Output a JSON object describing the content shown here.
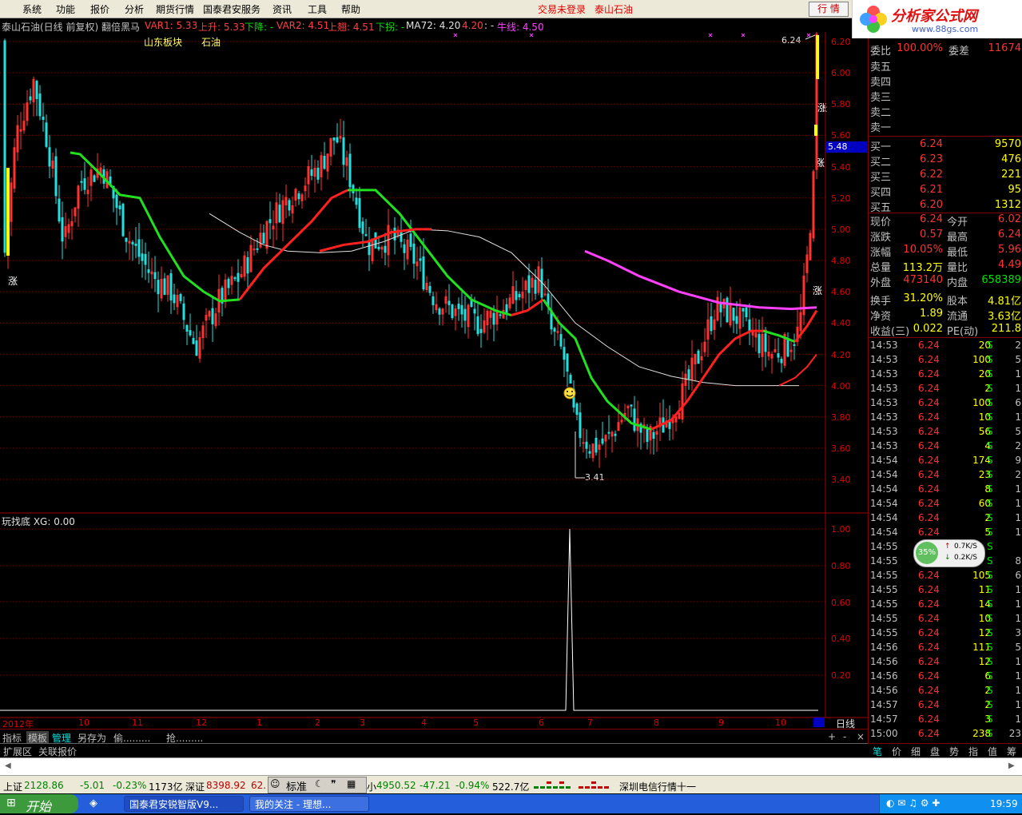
{
  "menu": {
    "items": [
      "系统",
      "功能",
      "报价",
      "分析",
      "期货行情",
      "国泰君安服务",
      "资讯",
      "工具",
      "帮助"
    ],
    "status_login": "交易未登录",
    "stock_name": "泰山石油",
    "hq_button": "行 情",
    "logo_text": "分析家公式网",
    "logo_url": "www.88gs.com"
  },
  "chart_header": {
    "title": "泰山石油(日线 前复权) 翻倍黑马",
    "var1": "VAR1: 5.33",
    "up": "上升: 5.33",
    "down": "下降: -",
    "var2": "VAR2: 4.51",
    "up_jump": "上翘: 4.51",
    "down_pull": "下拐: -",
    "ma72": "MA72: 4.20",
    "ma72b": "4.20",
    "ma72c": ": -",
    "bull": "牛线: 4.50",
    "block_label": "山东板块",
    "block_name": "石油",
    "high_label": "6.24",
    "low_label": "3.41",
    "rise_marks": [
      "涨",
      "涨",
      "涨",
      "涨"
    ]
  },
  "price_axis": [
    "6.20",
    "6.00",
    "5.80",
    "5.60",
    "5.40",
    "5.20",
    "5.00",
    "4.80",
    "4.60",
    "4.40",
    "4.20",
    "4.00",
    "3.80",
    "3.60",
    "3.40"
  ],
  "price_axis_highlight": "5.48",
  "indicator": {
    "title": "玩找底 XG: 0.00",
    "axis": [
      "1.00",
      "0.80",
      "0.60",
      "0.40",
      "0.20"
    ]
  },
  "time_axis": [
    "2012年",
    "10",
    "11",
    "12",
    "1",
    "2",
    "3",
    "4",
    "5",
    "6",
    "7",
    "8",
    "9",
    "10"
  ],
  "period_label": "日线",
  "tabs": [
    "指标",
    "模板",
    "管理",
    "另存为",
    "偷.........",
    "抢........."
  ],
  "ext_tabs": [
    "扩展区",
    "关联报价"
  ],
  "quote": {
    "weibi_label": "委比",
    "weibi": "100.00%",
    "weicha_label": "委差",
    "weicha": "11674",
    "sell": [
      {
        "label": "卖五",
        "price": "",
        "vol": ""
      },
      {
        "label": "卖四",
        "price": "",
        "vol": ""
      },
      {
        "label": "卖三",
        "price": "",
        "vol": ""
      },
      {
        "label": "卖二",
        "price": "",
        "vol": ""
      },
      {
        "label": "卖一",
        "price": "",
        "vol": ""
      }
    ],
    "buy": [
      {
        "label": "买一",
        "price": "6.24",
        "vol": "9570"
      },
      {
        "label": "买二",
        "price": "6.23",
        "vol": "476"
      },
      {
        "label": "买三",
        "price": "6.22",
        "vol": "221"
      },
      {
        "label": "买四",
        "price": "6.21",
        "vol": "95"
      },
      {
        "label": "买五",
        "price": "6.20",
        "vol": "1312"
      }
    ],
    "stats": [
      {
        "l1": "现价",
        "v1": "6.24",
        "l2": "今开",
        "v2": "6.02"
      },
      {
        "l1": "涨跌",
        "v1": "0.57",
        "l2": "最高",
        "v2": "6.24"
      },
      {
        "l1": "涨幅",
        "v1": "10.05%",
        "l2": "最低",
        "v2": "5.96"
      },
      {
        "l1": "总量",
        "v1": "113.2万",
        "l2": "量比",
        "v2": "4.49"
      },
      {
        "l1": "外盘",
        "v1": "473140",
        "l2": "内盘",
        "v2": "658389"
      },
      {
        "l1": "换手",
        "v1": "31.20%",
        "l2": "股本",
        "v2": "4.81亿"
      },
      {
        "l1": "净资",
        "v1": "1.89",
        "l2": "流通",
        "v2": "3.63亿"
      },
      {
        "l1": "收益(三)",
        "v1": "0.022",
        "l2": "PE(动)",
        "v2": "211.8"
      }
    ],
    "ticks": [
      {
        "t": "14:53",
        "p": "6.24",
        "v": "20",
        "s": "S",
        "n": "2"
      },
      {
        "t": "14:53",
        "p": "6.24",
        "v": "100",
        "s": "S",
        "n": "5"
      },
      {
        "t": "14:53",
        "p": "6.24",
        "v": "20",
        "s": "S",
        "n": "1"
      },
      {
        "t": "14:53",
        "p": "6.24",
        "v": "2",
        "s": "S",
        "n": "1"
      },
      {
        "t": "14:53",
        "p": "6.24",
        "v": "100",
        "s": "S",
        "n": "6"
      },
      {
        "t": "14:53",
        "p": "6.24",
        "v": "10",
        "s": "S",
        "n": "1"
      },
      {
        "t": "14:53",
        "p": "6.24",
        "v": "56",
        "s": "S",
        "n": "5"
      },
      {
        "t": "14:53",
        "p": "6.24",
        "v": "4",
        "s": "S",
        "n": "2"
      },
      {
        "t": "14:54",
        "p": "6.24",
        "v": "174",
        "s": "S",
        "n": "9"
      },
      {
        "t": "14:54",
        "p": "6.24",
        "v": "23",
        "s": "S",
        "n": "2"
      },
      {
        "t": "14:54",
        "p": "6.24",
        "v": "8",
        "s": "S",
        "n": "1"
      },
      {
        "t": "14:54",
        "p": "6.24",
        "v": "60",
        "s": "S",
        "n": "1"
      },
      {
        "t": "14:54",
        "p": "6.24",
        "v": "2",
        "s": "S",
        "n": "1"
      },
      {
        "t": "14:54",
        "p": "6.24",
        "v": "5",
        "s": "S",
        "n": "1"
      },
      {
        "t": "14:55",
        "p": "6.24",
        "v": "",
        "s": "S",
        "n": ""
      },
      {
        "t": "14:55",
        "p": "6.24",
        "v": "",
        "s": "S",
        "n": "8"
      },
      {
        "t": "14:55",
        "p": "6.24",
        "v": "105",
        "s": "S",
        "n": "6"
      },
      {
        "t": "14:55",
        "p": "6.24",
        "v": "11",
        "s": "S",
        "n": "1"
      },
      {
        "t": "14:55",
        "p": "6.24",
        "v": "14",
        "s": "S",
        "n": "1"
      },
      {
        "t": "14:55",
        "p": "6.24",
        "v": "10",
        "s": "S",
        "n": "1"
      },
      {
        "t": "14:55",
        "p": "6.24",
        "v": "12",
        "s": "S",
        "n": "3"
      },
      {
        "t": "14:56",
        "p": "6.24",
        "v": "111",
        "s": "S",
        "n": "5"
      },
      {
        "t": "14:56",
        "p": "6.24",
        "v": "12",
        "s": "S",
        "n": "1"
      },
      {
        "t": "14:56",
        "p": "6.24",
        "v": "6",
        "s": "S",
        "n": "1"
      },
      {
        "t": "14:56",
        "p": "6.24",
        "v": "2",
        "s": "S",
        "n": "1"
      },
      {
        "t": "14:57",
        "p": "6.24",
        "v": "2",
        "s": "S",
        "n": "1"
      },
      {
        "t": "14:57",
        "p": "6.24",
        "v": "3",
        "s": "S",
        "n": "1"
      },
      {
        "t": "15:00",
        "p": "6.24",
        "v": "238",
        "s": "S",
        "n": "23"
      }
    ],
    "bottom_tabs": [
      "笔",
      "价",
      "细",
      "盘",
      "势",
      "指",
      "值",
      "筹"
    ]
  },
  "network": {
    "percent": "35%",
    "up": "0.7K/S",
    "down": "0.2K/S"
  },
  "status_bar": {
    "sh_label": "上证",
    "sh": "2128.86",
    "sh_chg": "-5.01",
    "sh_pct": "-0.23%",
    "sh_amt": "1173亿",
    "sz_label": "深证",
    "sz": "8398.92",
    "sz_chg": "62.",
    "mode": "标准",
    "small_label": "小",
    "small": "4950.52",
    "small_chg": "-47.21",
    "small_pct": "-0.94%",
    "small_amt": "522.7亿",
    "ticker": "深圳电信行情十一"
  },
  "taskbar": {
    "start": "开始",
    "app1": "国泰君安锐智版V9...",
    "app2": "我的关注 - 理想...",
    "clock": "19:59"
  },
  "colors": {
    "up": "#ff3232",
    "down": "#00ff00",
    "ma_red": "#ff2020",
    "ma_green": "#20e020",
    "ma72": "#e0e0e0",
    "bull": "#ff40ff",
    "axis": "#a00000"
  }
}
